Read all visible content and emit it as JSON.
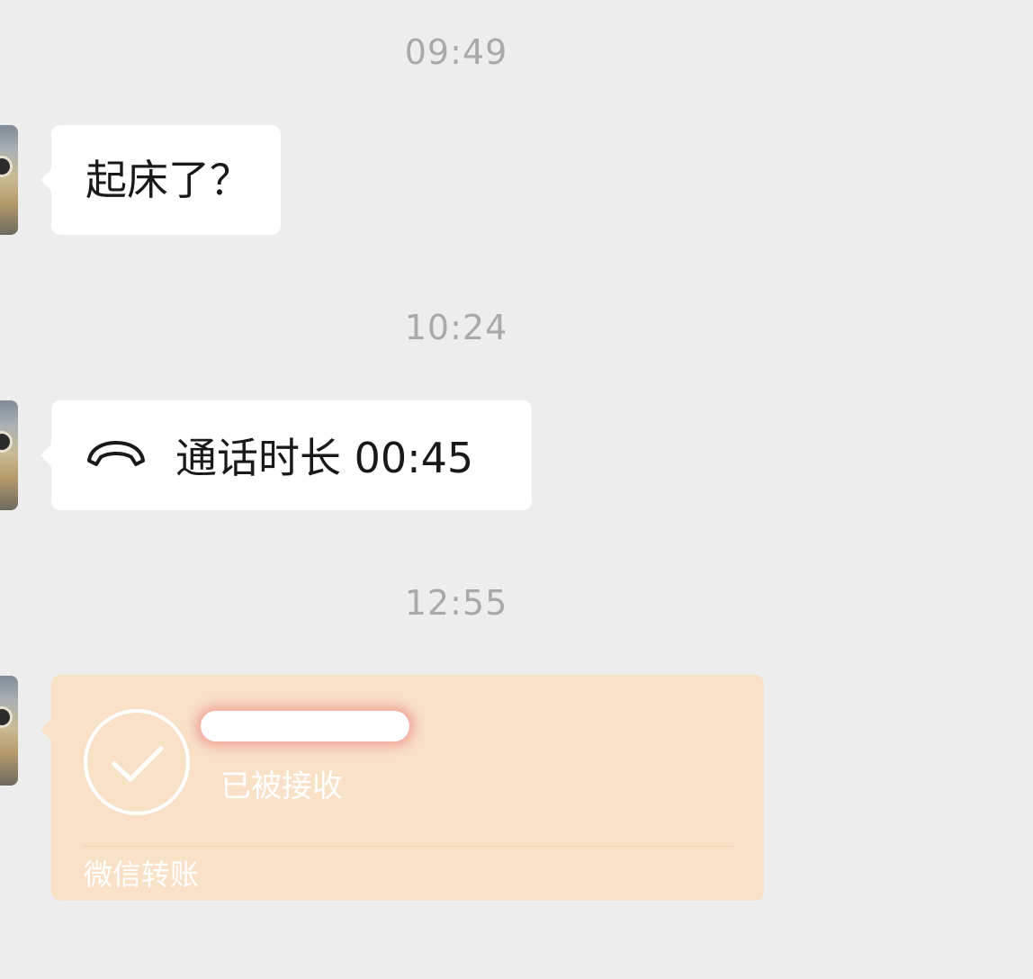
{
  "messages": {
    "time1": "09:49",
    "text1": "起床了？",
    "time2": "10:24",
    "call_label": "通话时长 00:45",
    "time3": "12:55",
    "transfer": {
      "status": "已被接收",
      "footer": "微信转账"
    }
  },
  "icons": {
    "call": "phone-hangup-icon",
    "transfer": "check-circle-icon"
  },
  "colors": {
    "background": "#ededed",
    "bubble": "#ffffff",
    "transfer_bubble": "#f8e1c7",
    "timestamp": "#a9a9a9"
  }
}
